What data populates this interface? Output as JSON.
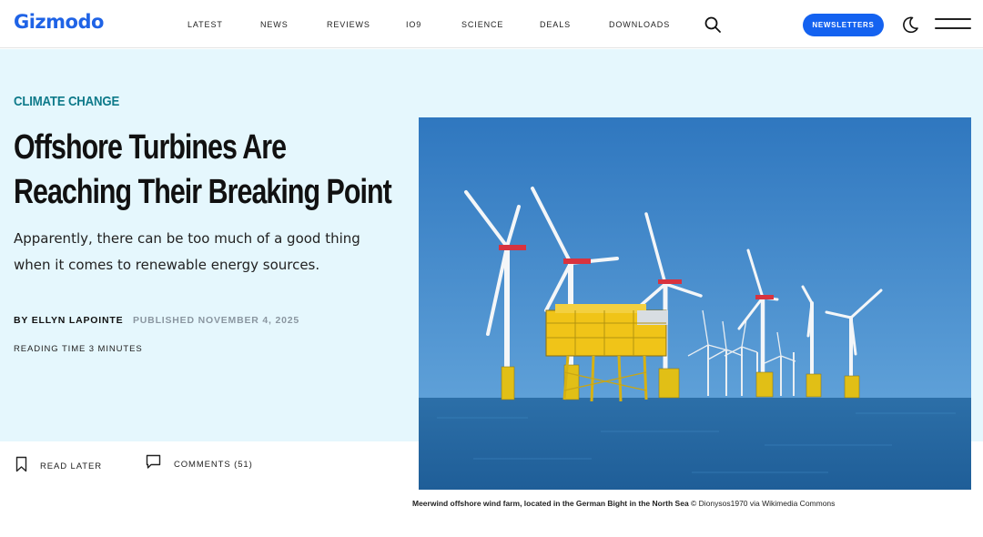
{
  "header": {
    "logo": "Gizmodo",
    "nav": [
      "LATEST",
      "NEWS",
      "REVIEWS",
      "IO9",
      "SCIENCE",
      "DEALS",
      "DOWNLOADS"
    ],
    "newsletter_label": "NEWSLETTERS",
    "brand_color": "#1f63e6"
  },
  "article": {
    "category": "CLIMATE CHANGE",
    "title_line1": "Offshore Turbines Are",
    "title_line2": "Reaching Their Breaking Point",
    "dek_line1": "Apparently, there can be too much of a good thing",
    "dek_line2": "when it comes to renewable energy sources.",
    "byline_prefix": "BY",
    "author": "ELLYN LAPOINTE",
    "published": "PUBLISHED NOVEMBER 4, 2025",
    "reading_time": "READING TIME 3 MINUTES",
    "hero_bg_color": "#e5f7fd",
    "category_color": "#0e7a8a"
  },
  "actions": {
    "read_later": "READ LATER",
    "comments": "COMMENTS (51)"
  },
  "image": {
    "caption_bold": "Meerwind offshore wind farm, located in the German Bight in the North Sea",
    "caption_credit": " © Dionysos1970 via Wikimedia Commons"
  },
  "icons": [
    "search-icon",
    "moon-icon",
    "hamburger-menu-icon",
    "bookmark-icon",
    "comment-icon"
  ]
}
